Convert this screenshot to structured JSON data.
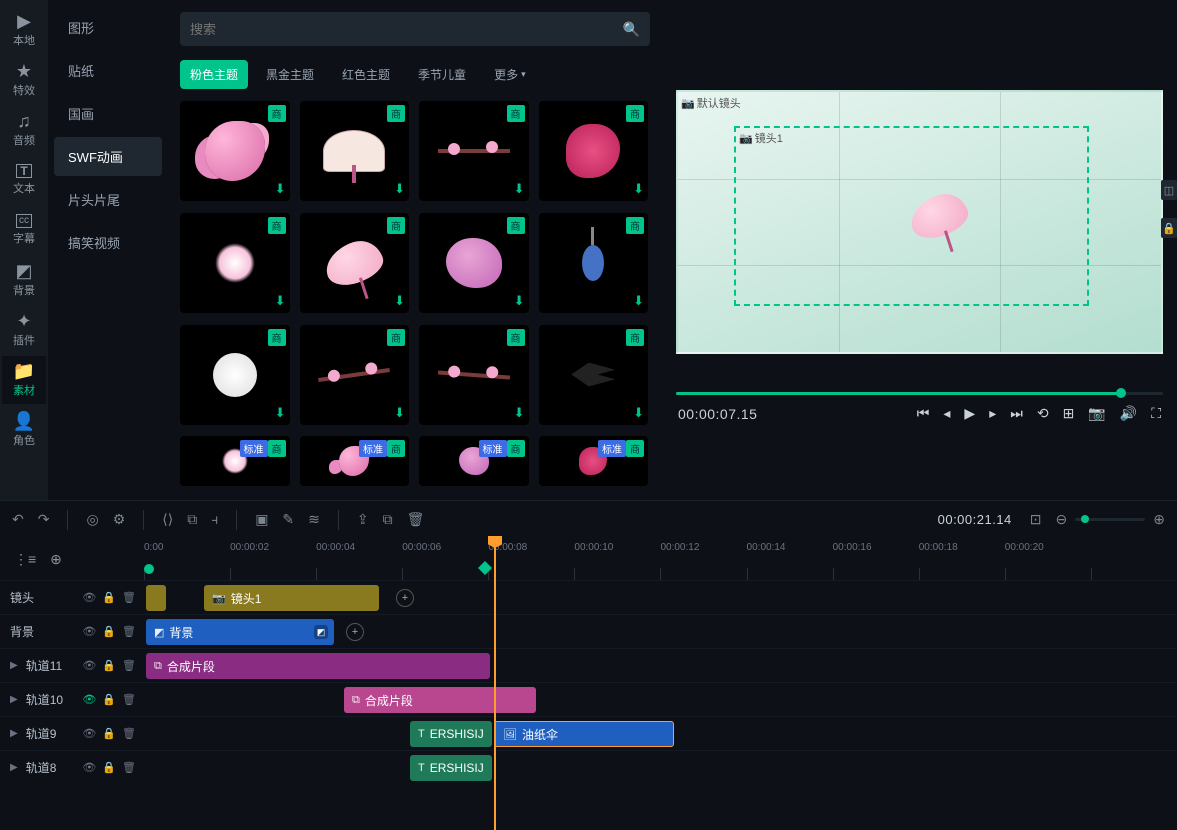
{
  "iconbar": {
    "items": [
      {
        "icon": "▶",
        "label": "本地"
      },
      {
        "icon": "★",
        "label": "特效"
      },
      {
        "icon": "♫",
        "label": "音频"
      },
      {
        "icon": "T",
        "label": "文本"
      },
      {
        "icon": "cc",
        "label": "字幕"
      },
      {
        "icon": "◩",
        "label": "背景"
      },
      {
        "icon": "✦",
        "label": "插件"
      },
      {
        "icon": "■",
        "label": "素材"
      },
      {
        "icon": "👤",
        "label": "角色"
      }
    ],
    "activeIndex": 7
  },
  "categories": {
    "items": [
      "图形",
      "贴纸",
      "国画",
      "SWF动画",
      "片头片尾",
      "搞笑视频"
    ],
    "activeIndex": 3
  },
  "search": {
    "placeholder": "搜索"
  },
  "themeTabs": {
    "items": [
      "粉色主题",
      "黑金主题",
      "红色主题",
      "季节儿童"
    ],
    "more": "更多",
    "activeIndex": 0
  },
  "assetBadges": {
    "commercial": "商",
    "standard": "标准"
  },
  "preview": {
    "defaultCamera": "默认镜头",
    "camera1": "镜头1",
    "time": "00:00:07.15"
  },
  "toolbar": {
    "timecode": "00:00:21.14"
  },
  "ruler": {
    "labels": [
      "0:00",
      "00:00:02",
      "00:00:04",
      "00:00:06",
      "00:00:08",
      "00:00:10",
      "00:00:12",
      "00:00:14",
      "00:00:16",
      "00:00:18",
      "00:00:20",
      ""
    ]
  },
  "tracks": {
    "camera": {
      "name": "镜头",
      "clip": "镜头1"
    },
    "bg": {
      "name": "背景",
      "clip": "背景"
    },
    "t11": {
      "name": "轨道11",
      "clip": "合成片段"
    },
    "t10": {
      "name": "轨道10",
      "clip": "合成片段"
    },
    "t9": {
      "name": "轨道9",
      "clipA": "ERSHISIJ",
      "clipB": "油纸伞"
    },
    "t8": {
      "name": "轨道8",
      "clipA": "ERSHISIJ"
    }
  }
}
